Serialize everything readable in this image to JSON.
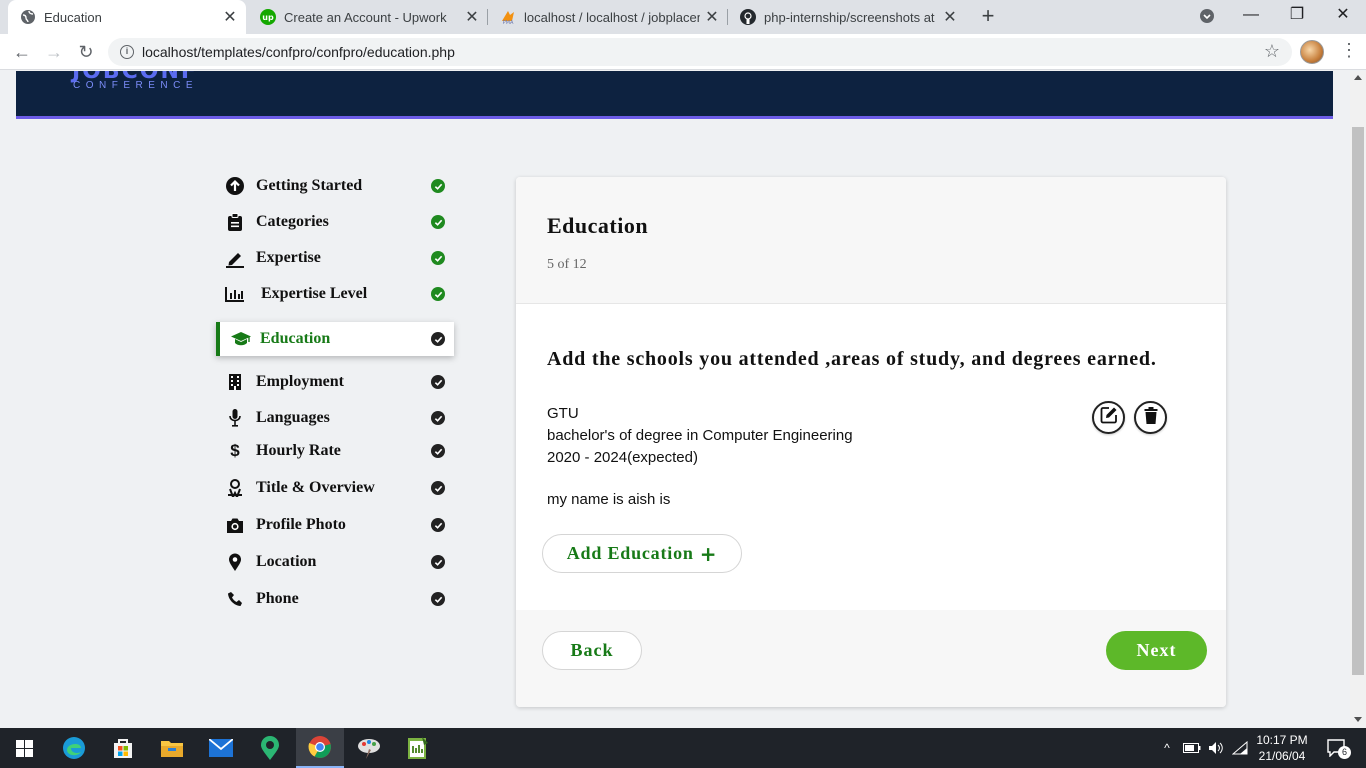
{
  "browser": {
    "tabs": [
      {
        "title": "Education",
        "active": true,
        "favicon": "globe-icon"
      },
      {
        "title": "Create an Account - Upwork",
        "active": false,
        "favicon": "upwork-icon"
      },
      {
        "title": "localhost / localhost / jobplacem",
        "active": false,
        "favicon": "phpmyadmin-icon"
      },
      {
        "title": "php-internship/screenshots at m",
        "active": false,
        "favicon": "github-icon"
      }
    ],
    "url": "localhost/templates/confpro/confpro/education.php"
  },
  "header": {
    "logo_top": "JOBCONF",
    "logo_sub": "CONFERENCE"
  },
  "steps": [
    {
      "label": "Getting Started",
      "icon": "arrow-up-circle-icon",
      "done": true
    },
    {
      "label": "Categories",
      "icon": "clipboard-icon",
      "done": true
    },
    {
      "label": "Expertise",
      "icon": "pen-icon",
      "done": true
    },
    {
      "label": "Expertise Level",
      "icon": "bar-chart-icon",
      "done": true
    },
    {
      "label": "Education",
      "icon": "graduation-cap-icon",
      "done": false,
      "active": true
    },
    {
      "label": "Employment",
      "icon": "building-icon",
      "done": false
    },
    {
      "label": "Languages",
      "icon": "microphone-icon",
      "done": false
    },
    {
      "label": "Hourly Rate",
      "icon": "dollar-icon",
      "done": false
    },
    {
      "label": "Title & Overview",
      "icon": "user-badge-icon",
      "done": false
    },
    {
      "label": "Profile Photo",
      "icon": "camera-icon",
      "done": false
    },
    {
      "label": "Location",
      "icon": "map-pin-icon",
      "done": false
    },
    {
      "label": "Phone",
      "icon": "phone-icon",
      "done": false
    }
  ],
  "card": {
    "title": "Education",
    "step": "5 of 12",
    "prompt": "Add the schools you attended ,areas of study, and degrees earned.",
    "entry": {
      "school": "GTU",
      "degree": "bachelor's of degree in Computer Engineering",
      "years": "2020 - 2024(expected)",
      "description": "my name is aish is"
    },
    "add_label": "Add Education",
    "back_label": "Back",
    "next_label": "Next"
  },
  "taskbar": {
    "time": "10:17 PM",
    "date": "21/06/04",
    "notifications": "6"
  },
  "colors": {
    "header_bg": "#0d2240",
    "accent_green": "#177a17",
    "next_green": "#5db829",
    "done_check": "#1f8a1f",
    "pending_check": "#222222"
  }
}
